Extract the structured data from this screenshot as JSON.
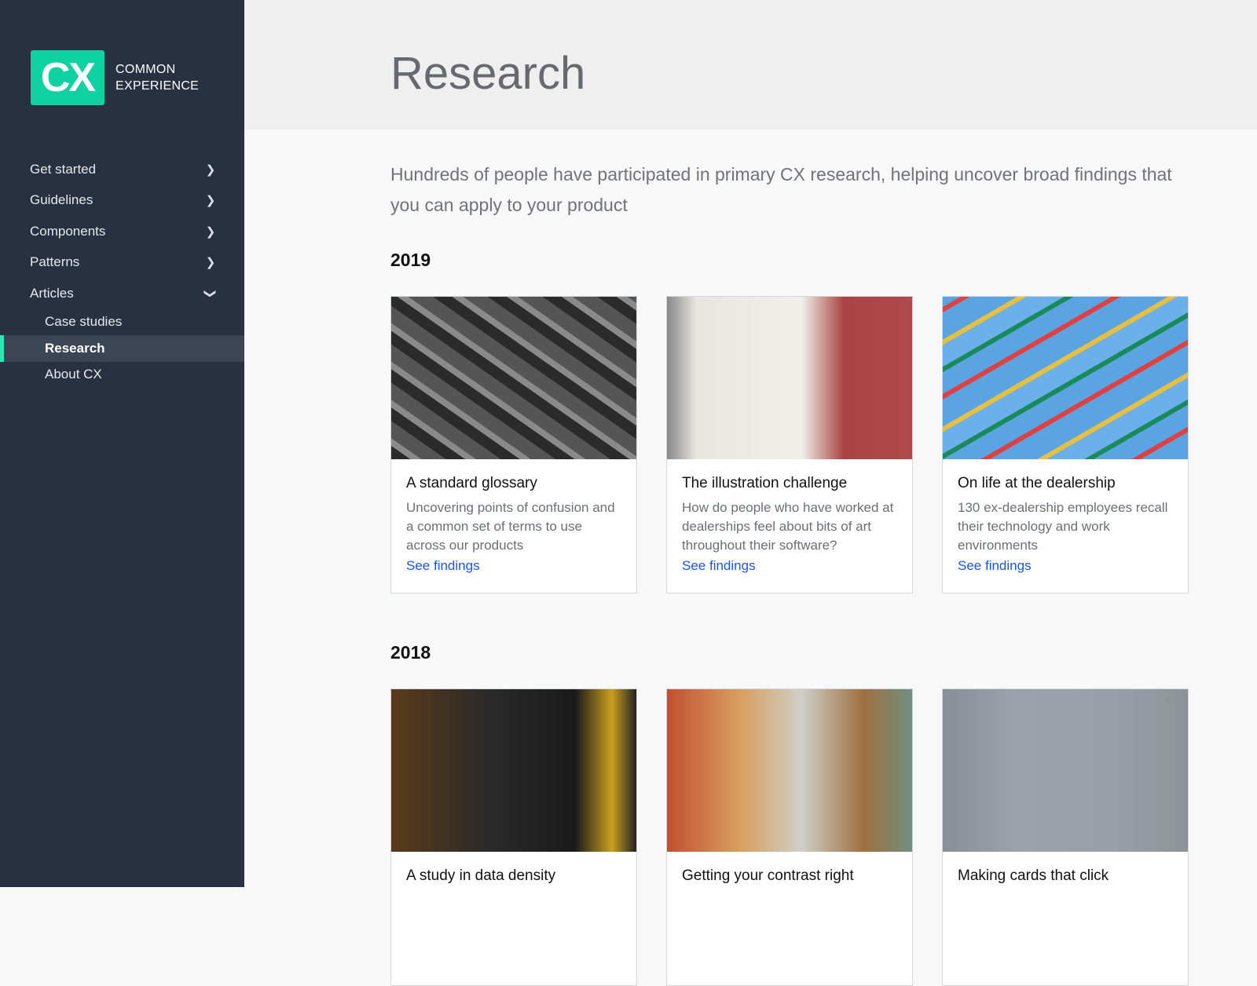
{
  "logo": {
    "mark": "CX",
    "line1": "COMMON",
    "line2": "EXPERIENCE"
  },
  "nav": {
    "items": [
      {
        "label": "Get started",
        "icon": "chevron-right-icon"
      },
      {
        "label": "Guidelines",
        "icon": "chevron-right-icon"
      },
      {
        "label": "Components",
        "icon": "chevron-right-icon"
      },
      {
        "label": "Patterns",
        "icon": "chevron-right-icon"
      },
      {
        "label": "Articles",
        "icon": "chevron-down-icon"
      }
    ],
    "sub": [
      {
        "label": "Case studies"
      },
      {
        "label": "Research",
        "active": true
      },
      {
        "label": "About CX"
      }
    ]
  },
  "page": {
    "title": "Research",
    "intro": "Hundreds of people have participated in primary CX research, helping uncover broad findings that you can apply to your product"
  },
  "sections": [
    {
      "year": "2019",
      "cards": [
        {
          "title": "A standard glossary",
          "desc": "Uncovering points of confusion and a common set of terms to use across our products",
          "link": "See findings"
        },
        {
          "title": "The illustration challenge",
          "desc": "How do people who have worked at dealerships feel about bits of art throughout their software?",
          "link": "See findings"
        },
        {
          "title": "On life at the dealership",
          "desc": "130 ex-dealership employees recall their technology and work environments",
          "link": "See findings"
        }
      ]
    },
    {
      "year": "2018",
      "cards": [
        {
          "title": "A study in data density"
        },
        {
          "title": "Getting your contrast right"
        },
        {
          "title": "Making cards that click"
        }
      ]
    }
  ],
  "colors": {
    "sidebar": "#283142",
    "accent": "#0fd1a2",
    "link": "#1a56e6"
  }
}
